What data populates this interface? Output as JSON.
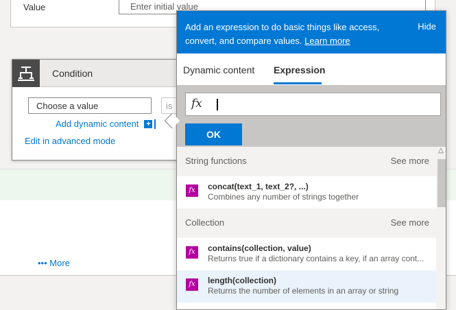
{
  "variable_card": {
    "value_label": "Value",
    "value_placeholder": "Enter initial value"
  },
  "condition": {
    "title": "Condition",
    "choose_value_placeholder": "Choose a value",
    "operator_text": "is",
    "add_dynamic_content": "Add dynamic content",
    "add_dynamic_plus": "+",
    "edit_advanced": "Edit in advanced mode"
  },
  "more_link": "••• More",
  "expression_panel": {
    "description": "Add an expression to do basic things like access, convert, and compare values.",
    "learn_more": "Learn more",
    "hide": "Hide",
    "tabs": [
      {
        "label": "Dynamic content",
        "active": false
      },
      {
        "label": "Expression",
        "active": true
      }
    ],
    "fx_symbol": "fx",
    "expression_value": "",
    "ok_label": "OK",
    "sections": [
      {
        "title": "String functions",
        "see_more": "See more",
        "items": [
          {
            "signature": "concat(text_1, text_2?, ...)",
            "description": "Combines any number of strings together"
          }
        ]
      },
      {
        "title": "Collection",
        "see_more": "See more",
        "items": [
          {
            "signature": "contains(collection, value)",
            "description": "Returns true if a dictionary contains a key, if an array cont..."
          },
          {
            "signature": "length(collection)",
            "description": "Returns the number of elements in an array or string"
          }
        ]
      }
    ]
  },
  "colors": {
    "accent": "#0078d4",
    "function_icon": "#b4009e",
    "selected_row": "#eaf3fb"
  }
}
